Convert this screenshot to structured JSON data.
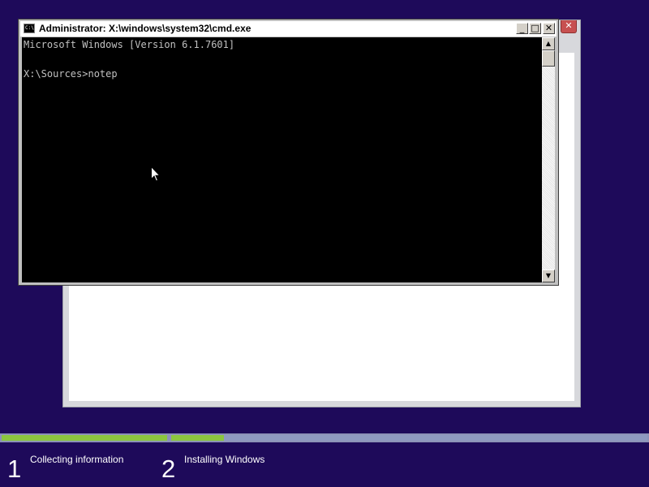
{
  "setup_window": {
    "close_glyph": "✕"
  },
  "cmd_window": {
    "title": "Administrator: X:\\windows\\system32\\cmd.exe",
    "app_icon_text": "C:\\",
    "buttons": {
      "minimize": "_",
      "maximize": "□",
      "close": "✕"
    },
    "console_text": "Microsoft Windows [Version 6.1.7601]\n\nX:\\Sources>notep",
    "scrollbar": {
      "up": "▲",
      "down": "▼"
    }
  },
  "progress": {
    "steps": [
      {
        "number": "1",
        "label": "Collecting information",
        "fill_fraction": 1.0
      },
      {
        "number": "2",
        "label": "Installing Windows",
        "fill_fraction": 0.11
      }
    ],
    "colors": {
      "fill": "#8cc63f",
      "track": "#8f9ac0",
      "background": "#1e0a5a"
    }
  }
}
